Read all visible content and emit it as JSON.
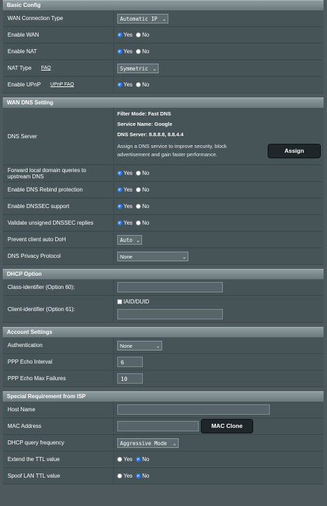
{
  "basic": {
    "title": "Basic Config",
    "wan_type_label": "WAN Connection Type",
    "wan_type_value": "Automatic IP",
    "enable_wan_label": "Enable WAN",
    "enable_nat_label": "Enable NAT",
    "nat_type_label": "NAT Type",
    "nat_faq": "FAQ",
    "nat_type_value": "Symmetric",
    "upnp_label": "Enable UPnP",
    "upnp_faq": "UPnP FAQ"
  },
  "radio": {
    "yes": "Yes",
    "no": "No"
  },
  "dns": {
    "title": "WAN DNS Setting",
    "server_label": "DNS Server",
    "filter_mode": "Filter Mode: Fast DNS",
    "service_name": "Service Name: Google",
    "dns_server": "DNS Server: 8.8.8.8, 8.8.4.4",
    "assign_desc": "Assign a DNS service to improve security, block advertisement and gain faster performance.",
    "assign_button": "Assign",
    "forward_label": "Forward local domain queries to upstream DNS",
    "rebind_label": "Enable DNS Rebind protection",
    "dnssec_label": "Enable DNSSEC support",
    "validate_label": "Validate unsigned DNSSEC replies",
    "doh_label": "Prevent client auto DoH",
    "doh_value": "Auto",
    "privacy_label": "DNS Privacy Protocol",
    "privacy_value": "None"
  },
  "dhcp": {
    "title": "DHCP Option",
    "class_label": "Class-identifier (Option 60):",
    "class_value": "",
    "client_label": "Client-identifier (Option 61):",
    "iaid_label": "IAID/DUID",
    "client_value": ""
  },
  "account": {
    "title": "Account Settings",
    "auth_label": "Authentication",
    "auth_value": "None",
    "echo_interval_label": "PPP Echo Interval",
    "echo_interval_value": "6",
    "echo_max_label": "PPP Echo Max Failures",
    "echo_max_value": "10"
  },
  "isp": {
    "title": "Special Requirement from ISP",
    "host_label": "Host Name",
    "host_value": "",
    "mac_label": "MAC Address",
    "mac_value": "",
    "mac_clone_button": "MAC Clone",
    "dhcp_freq_label": "DHCP query frequency",
    "dhcp_freq_value": "Aggressive Mode",
    "ttl_label": "Extend the TTL value",
    "spoof_label": "Spoof LAN TTL value"
  },
  "colors": {
    "accent": "#2a7cff",
    "panel": "#475457",
    "background": "#4d595d"
  }
}
